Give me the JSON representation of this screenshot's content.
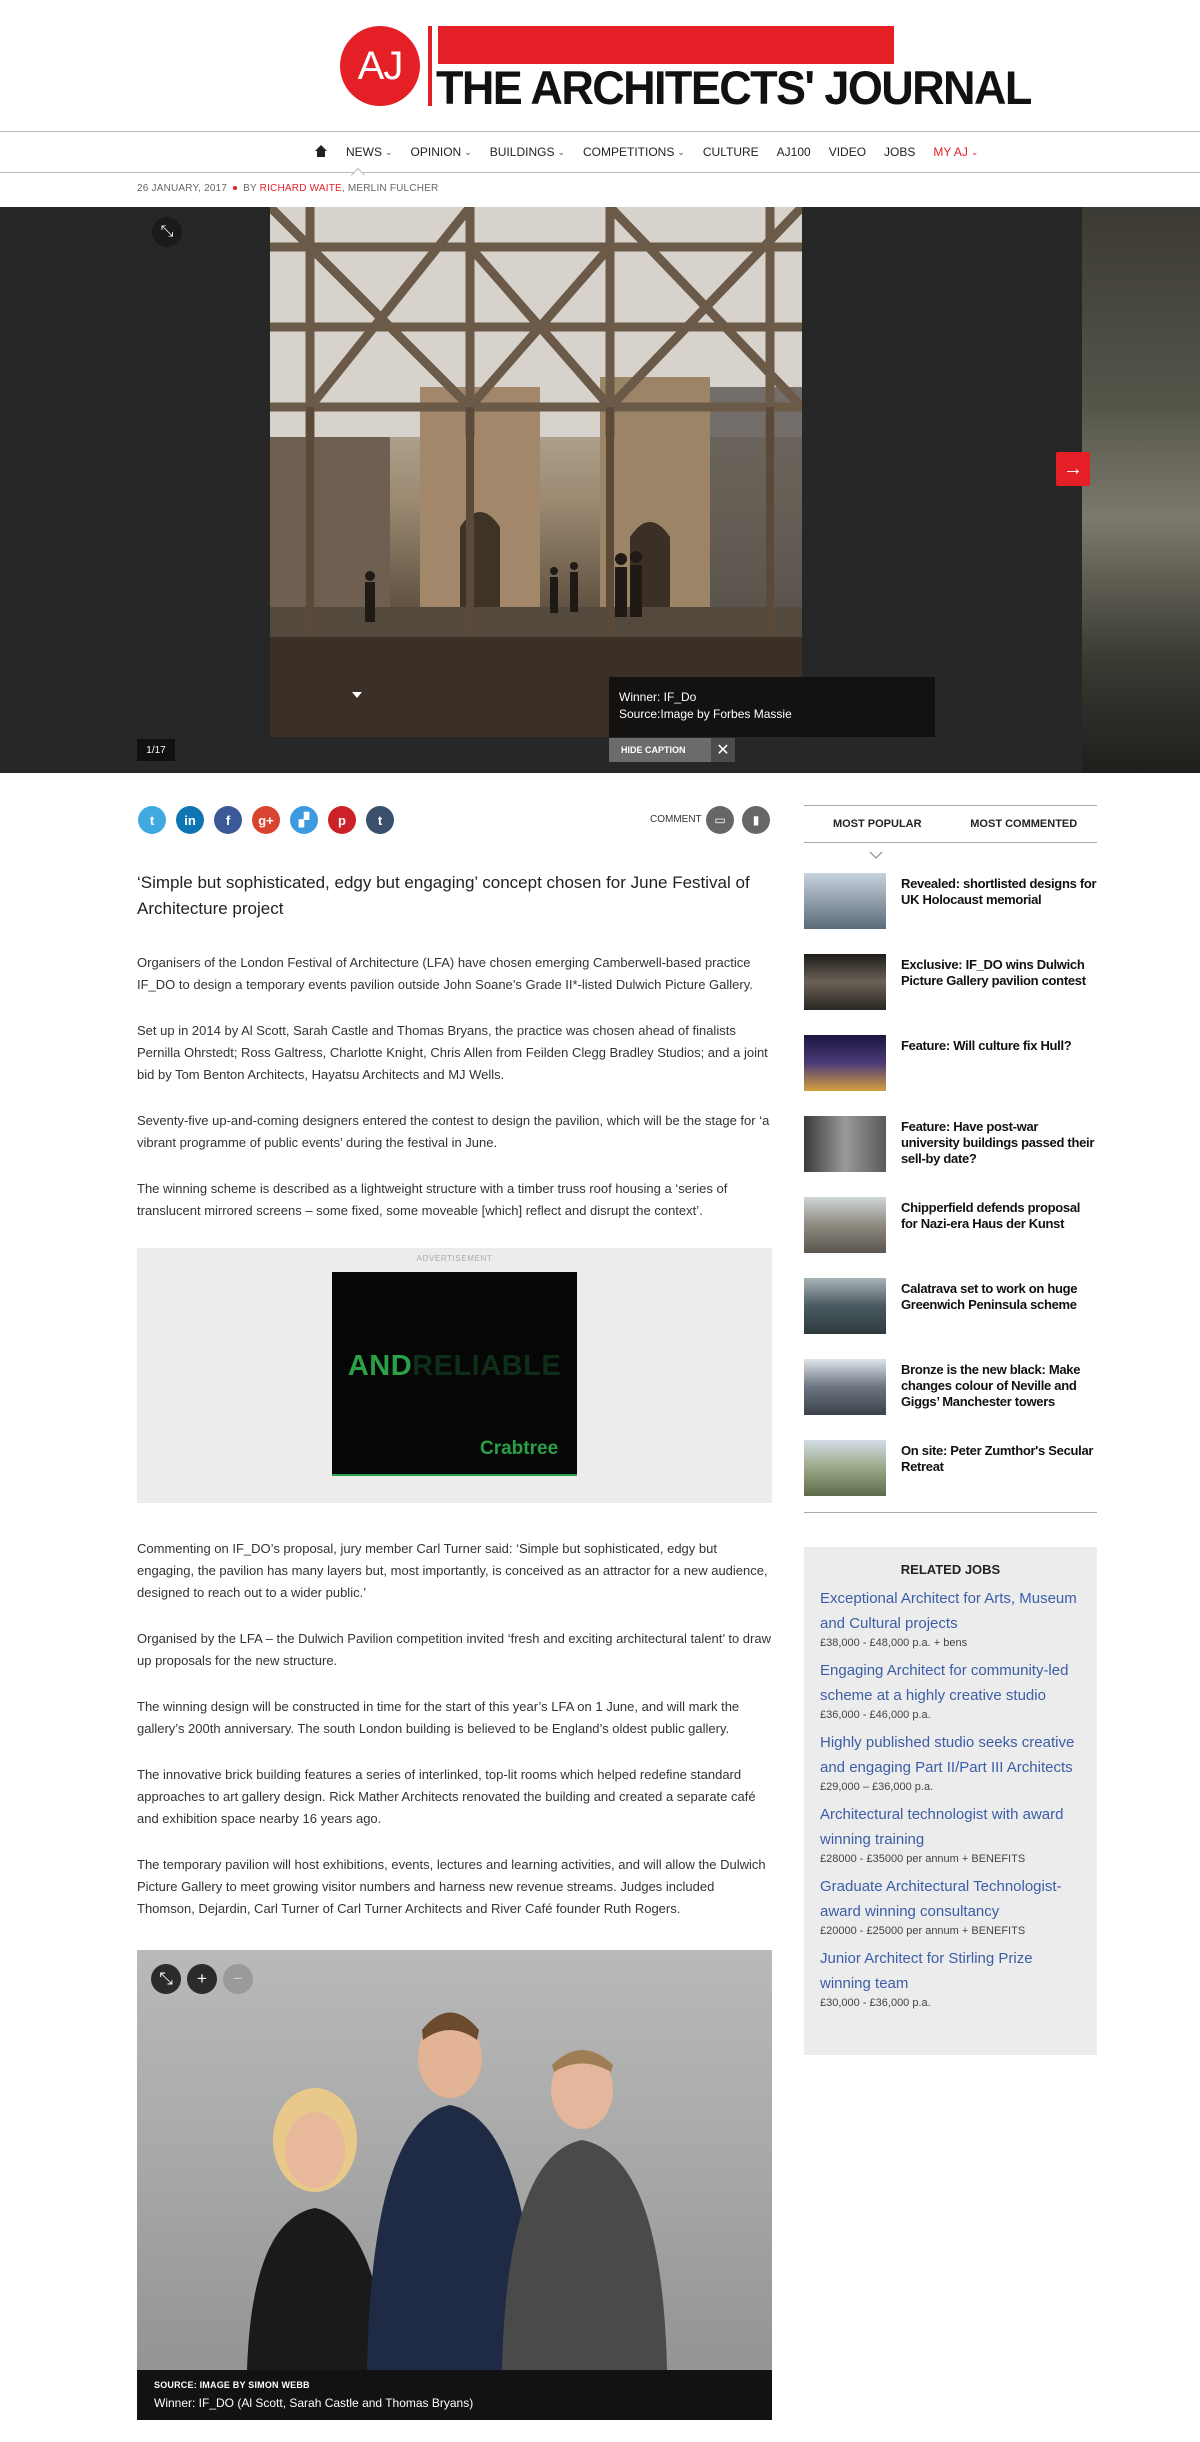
{
  "brand": {
    "logo_letters": "AJ",
    "title": "THE ARCHITECTS' JOURNAL",
    "accent": "#e41f26"
  },
  "nav": {
    "home_icon": "home-icon",
    "items": [
      {
        "label": "NEWS",
        "dropdown": true
      },
      {
        "label": "OPINION",
        "dropdown": true
      },
      {
        "label": "BUILDINGS",
        "dropdown": true
      },
      {
        "label": "COMPETITIONS",
        "dropdown": true
      },
      {
        "label": "CULTURE",
        "dropdown": false
      },
      {
        "label": "AJ100",
        "dropdown": false
      },
      {
        "label": "VIDEO",
        "dropdown": false
      },
      {
        "label": "JOBS",
        "dropdown": false
      },
      {
        "label": "MY AJ",
        "dropdown": true
      }
    ]
  },
  "byline": {
    "date": "26 JANUARY, 2017",
    "by": "BY",
    "author1": "RICHARD WAITE",
    "author2": "MERLIN FULCHER"
  },
  "gallery": {
    "counter": "1/17",
    "caption_title": "Winner: IF_Do",
    "caption_source": "Source:Image by Forbes Massie",
    "hide_caption_label": "HIDE CAPTION"
  },
  "share": {
    "networks": [
      {
        "icon": "twitter-icon",
        "glyph": "t",
        "color": "#3fa9e0"
      },
      {
        "icon": "linkedin-icon",
        "glyph": "in",
        "color": "#0f75b2"
      },
      {
        "icon": "facebook-icon",
        "glyph": "f",
        "color": "#3c5a98"
      },
      {
        "icon": "googleplus-icon",
        "glyph": "g+",
        "color": "#d8442f"
      },
      {
        "icon": "delicious-icon",
        "glyph": "▞",
        "color": "#3d9ae0"
      },
      {
        "icon": "pinterest-icon",
        "glyph": "p",
        "color": "#cc2127"
      },
      {
        "icon": "tumblr-icon",
        "glyph": "t",
        "color": "#3a4f6b"
      }
    ],
    "comment_label": "COMMENT"
  },
  "article": {
    "standfirst": "‘Simple but sophisticated, edgy but engaging’ concept chosen for June Festival of Architecture project",
    "paragraphs": [
      "Organisers of the London Festival of Architecture (LFA) have chosen emerging Camberwell-based practice IF_DO to design a temporary events pavilion outside John Soane’s Grade II*-listed Dulwich Picture Gallery.",
      "Set up in 2014 by Al Scott, Sarah Castle and Thomas Bryans, the practice was chosen ahead of finalists Pernilla Ohrstedt; Ross Galtress, Charlotte Knight, Chris Allen from Feilden Clegg Bradley Studios; and a joint bid by Tom Benton Architects, Hayatsu Architects and MJ Wells.",
      "Seventy-five up-and-coming designers entered the contest to design the pavilion, which will be the stage for ‘a vibrant programme of public events’ during the festival in June.",
      "The winning scheme is described as a lightweight structure with a timber truss roof housing a ‘series of translucent mirrored screens – some fixed, some moveable [which] reflect and disrupt the context’.",
      "Commenting on IF_DO’s proposal, jury member Carl Turner said: ‘Simple but sophisticated, edgy but engaging, the pavilion has many layers but, most importantly, is conceived as an attractor for a new audience, designed to reach out to a wider public.’",
      "Organised by the LFA – the Dulwich Pavilion competition invited ‘fresh and exciting architectural talent’ to draw up proposals for the new structure.",
      "The winning design will be constructed in time for the start of this year’s LFA on 1 June, and will mark the gallery’s 200th anniversary. The south London building is believed to be England’s oldest public gallery.",
      "The innovative brick building features a series of interlinked, top-lit rooms which helped redefine standard approaches to art gallery design. Rick Mather Architects renovated the building and created a separate café and exhibition space nearby 16 years ago.",
      "The temporary pavilion will host exhibitions, events, lectures and learning activities, and will allow the Dulwich Picture Gallery to meet growing visitor numbers and harness new revenue streams. Judges included Thomson, Dejardin, Carl Turner of Carl Turner Architects and River Café founder Ruth Rogers."
    ],
    "photo_source": "SOURCE: IMAGE BY SIMON WEBB",
    "photo_caption": "Winner: IF_DO (Al Scott, Sarah Castle and Thomas Bryans)"
  },
  "ad": {
    "label": "ADVERTISEMENT",
    "headline_bright": "AND",
    "headline_dim": "RELIABLE",
    "brand": "Crabtree"
  },
  "sidebar": {
    "tabs": [
      "MOST POPULAR",
      "MOST COMMENTED"
    ],
    "popular": [
      {
        "title": "Revealed: shortlisted designs for UK Holocaust memorial",
        "thumb": "#5b6b78"
      },
      {
        "title": "Exclusive: IF_DO wins Dulwich Picture Gallery pavilion contest",
        "thumb": "#3a3630"
      },
      {
        "title": "Feature: Will culture fix Hull?",
        "thumb": "#3b2f5a"
      },
      {
        "title": "Feature: Have post-war university buildings passed their sell-by date?",
        "thumb": "#7a7a7a"
      },
      {
        "title": "Chipperfield defends proposal for Nazi-era Haus der Kunst",
        "thumb": "#8f8a80"
      },
      {
        "title": "Calatrava set to work on huge Greenwich Peninsula scheme",
        "thumb": "#4a5a60"
      },
      {
        "title": "Bronze is the new black: Make changes colour of Neville and Giggs’ Manchester towers",
        "thumb": "#6b7480"
      },
      {
        "title": "On site: Peter Zumthor's Secular Retreat",
        "thumb": "#7d8a70"
      }
    ],
    "jobs_title": "RELATED JOBS",
    "jobs": [
      {
        "title": "Exceptional Architect for Arts, Museum and Cultural projects",
        "pay": "£38,000 - £48,000 p.a. + bens"
      },
      {
        "title": "Engaging Architect for community-led scheme at a highly creative studio",
        "pay": "£36,000 - £46,000 p.a."
      },
      {
        "title": "Highly published studio seeks creative and engaging Part II/Part III Architects",
        "pay": "£29,000 – £36,000 p.a."
      },
      {
        "title": "Architectural technologist with award winning training",
        "pay": "£28000 - £35000 per annum + BENEFITS"
      },
      {
        "title": "Graduate Architectural Technologist- award winning consultancy",
        "pay": "£20000 - £25000 per annum + BENEFITS"
      },
      {
        "title": "Junior Architect for Stirling Prize winning team",
        "pay": "£30,000 - £36,000 p.a."
      }
    ]
  }
}
